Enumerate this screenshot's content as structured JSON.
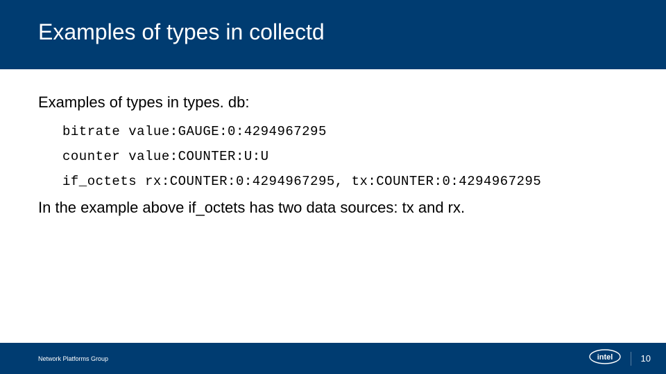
{
  "title": "Examples of types in collectd",
  "subtitle": "Examples of types in types. db:",
  "code_lines": [
    "bitrate value:GAUGE:0:4294967295",
    "counter value:COUNTER:U:U",
    "if_octets rx:COUNTER:0:4294967295, tx:COUNTER:0:4294967295"
  ],
  "explain": "In the example above if_octets has two data sources: tx and rx.",
  "footer_text": "Network Platforms Group",
  "page_number": "10",
  "logo_name": "intel"
}
